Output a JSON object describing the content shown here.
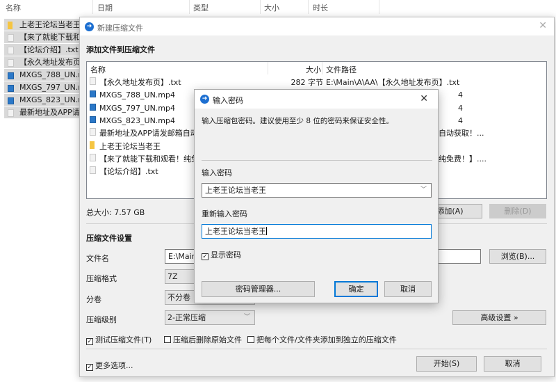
{
  "explorer": {
    "columns": [
      "名称",
      "日期",
      "类型",
      "大小",
      "时长"
    ],
    "items": [
      {
        "name": "上老王论坛当老王",
        "icon": "folder-icon"
      },
      {
        "name": "【来了就能下载和观看！纯免费！】",
        "icon": "file-icon"
      },
      {
        "name": "【论坛介绍】.txt",
        "icon": "file-icon"
      },
      {
        "name": "【永久地址发布页】.txt",
        "icon": "file-icon"
      },
      {
        "name": "MXGS_788_UN.mp4",
        "icon": "video-icon"
      },
      {
        "name": "MXGS_797_UN.mp4",
        "icon": "video-icon"
      },
      {
        "name": "MXGS_823_UN.mp4",
        "icon": "video-icon"
      },
      {
        "name": "最新地址及APP请发邮箱自动获取！",
        "icon": "file-icon"
      }
    ]
  },
  "main": {
    "title": "新建压缩文件",
    "section_add": "添加文件到压缩文件",
    "list_headers": {
      "name": "名称",
      "size": "大小",
      "path": "文件路径"
    },
    "files": [
      {
        "name": "【永久地址发布页】.txt",
        "size": "282 字节",
        "path": "E:\\Main\\A\\AA\\【永久地址发布页】.txt",
        "icon": "file-icon"
      },
      {
        "name": "MXGS_788_UN.mp4",
        "size": "",
        "path": "4",
        "icon": "video-icon"
      },
      {
        "name": "MXGS_797_UN.mp4",
        "size": "",
        "path": "4",
        "icon": "video-icon"
      },
      {
        "name": "MXGS_823_UN.mp4",
        "size": "",
        "path": "4",
        "icon": "video-icon"
      },
      {
        "name": "最新地址及APP请发邮箱自动获取！",
        "size": "",
        "path": "邮箱自动获取！...",
        "icon": "file-icon"
      },
      {
        "name": "上老王论坛当老王",
        "size": "",
        "path": "",
        "icon": "folder-icon"
      },
      {
        "name": "【来了就能下载和观看！纯免费！】",
        "size": "",
        "path": "看！纯免费！】....",
        "icon": "file-icon"
      },
      {
        "name": "【论坛介绍】.txt",
        "size": "",
        "path": "",
        "icon": "file-icon"
      }
    ],
    "total_size": "总大小: 7.57 GB",
    "add_btn": "添加(A)",
    "delete_btn": "删除(D)",
    "settings_title": "压缩文件设置",
    "filename_label": "文件名",
    "filename_value": "E:\\Main\\",
    "browse_btn": "浏览(B)...",
    "format_label": "压缩格式",
    "format_value": "7Z",
    "split_label": "分卷",
    "split_value": "不分卷",
    "level_label": "压缩级别",
    "level_value": "2-正常压缩",
    "advanced_btn": "高级设置 »",
    "test_cb": "测试压缩文件(T)",
    "test_checked": true,
    "delete_cb": "压缩后删除原始文件",
    "delete_checked": false,
    "separate_cb": "把每个文件/文件夹添加到独立的压缩文件",
    "separate_checked": false,
    "more_cb": "更多选项...",
    "more_checked": true,
    "start_btn": "开始(S)",
    "cancel_btn": "取消"
  },
  "password": {
    "title": "输入密码",
    "description": "输入压缩包密码。建议使用至少 8 位的密码来保证安全性。",
    "pw_label": "输入密码",
    "pw_value": "上老王论坛当老王",
    "repeat_label": "重新输入密码",
    "repeat_value": "上老王论坛当老王",
    "show_cb": "显示密码",
    "show_checked": true,
    "manager_btn": "密码管理器...",
    "ok_btn": "确定",
    "cancel_btn": "取消"
  },
  "colors": {
    "accent": "#0078d7",
    "selection": "#d9d9d9"
  }
}
